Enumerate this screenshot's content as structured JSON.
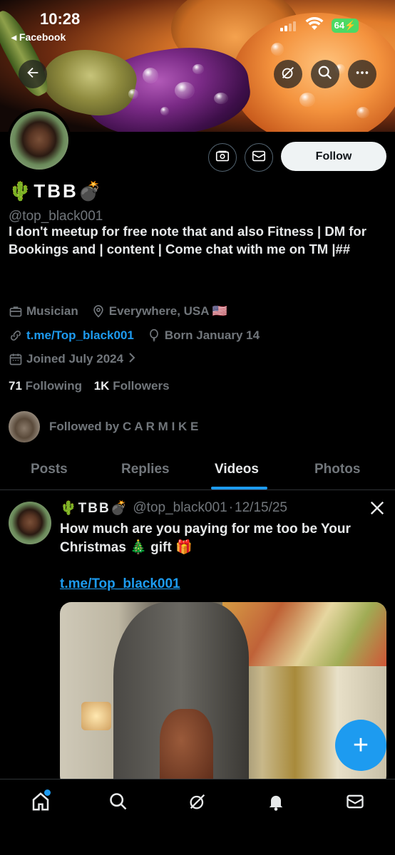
{
  "status_bar": {
    "time": "10:28",
    "back_app": "◂ Facebook",
    "battery": "64"
  },
  "profile": {
    "name": "🌵TBB💣",
    "handle": "@top_black001",
    "bio": "I don't meetup for free note that and also Fitness | DM for Bookings and | content | Come chat with me on TM |##",
    "category": "Musician",
    "location": "Everywhere, USA 🇺🇸",
    "website": "t.me/Top_black001",
    "birthday": "Born January 14",
    "joined": "Joined July 2024",
    "following_count": "71",
    "following_label": "Following",
    "followers_count": "1K",
    "followers_label": "Followers",
    "followed_by": "Followed by C A R M I K E",
    "follow_button": "Follow"
  },
  "tabs": [
    {
      "label": "Posts",
      "active": false
    },
    {
      "label": "Replies",
      "active": false
    },
    {
      "label": "Videos",
      "active": true
    },
    {
      "label": "Photos",
      "active": false
    }
  ],
  "post": {
    "author_name": "🌵TBB💣",
    "author_handle": "@top_black001",
    "separator": "·",
    "date": "12/15/25",
    "text": "How much are you paying for me too be Your Christmas 🎄 gift 🎁",
    "link": "t.me/Top_black001"
  },
  "fab": {
    "label": "+"
  },
  "icons": {
    "back": "arrow-left-icon",
    "grok": "grok-icon",
    "search": "search-icon",
    "more": "more-icon",
    "subscribe": "money-icon",
    "message": "mail-icon",
    "x": "x-logo-icon"
  },
  "colors": {
    "accent": "#1d9bf0",
    "background": "#000000",
    "text_secondary": "#71767b"
  }
}
